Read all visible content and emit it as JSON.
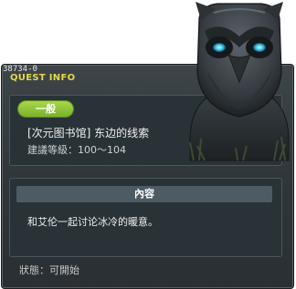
{
  "quest": {
    "id": "38734-0",
    "header": "QUEST INFO",
    "category": "一般",
    "title": "[次元图书馆] 东边的线索",
    "level_requirement": "建議等級：100～104"
  },
  "content": {
    "header": "內容",
    "text": "和艾伦一起讨论冰冷的暖意。"
  },
  "status": "狀態：可開始",
  "npc": {
    "icon": "masked-owl-npc-icon"
  },
  "colors": {
    "panel": "#343b3f",
    "header_text": "#e6d84a",
    "badge": "#8fc43a"
  }
}
